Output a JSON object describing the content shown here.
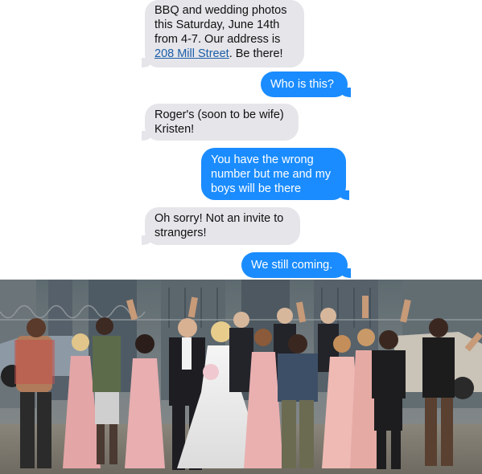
{
  "messages": [
    {
      "from": "them",
      "parts": {
        "before": "BBQ and wedding photos this Saturday, June 14th from 4-7. Our address is ",
        "link": "208 Mill Street",
        "after": ". Be there!"
      }
    },
    {
      "from": "me",
      "text": "Who is this?"
    },
    {
      "from": "them",
      "text": "Roger's (soon to be wife) Kristen!"
    },
    {
      "from": "me",
      "text": "You have the wrong number but me and my boys will be there"
    },
    {
      "from": "them",
      "text": "Oh sorry! Not an invite to strangers!"
    },
    {
      "from": "me",
      "text": "We still coming."
    }
  ],
  "colors": {
    "incoming_bubble": "#e5e5ea",
    "outgoing_bubble": "#1a8cff",
    "link": "#1b5ea8"
  }
}
